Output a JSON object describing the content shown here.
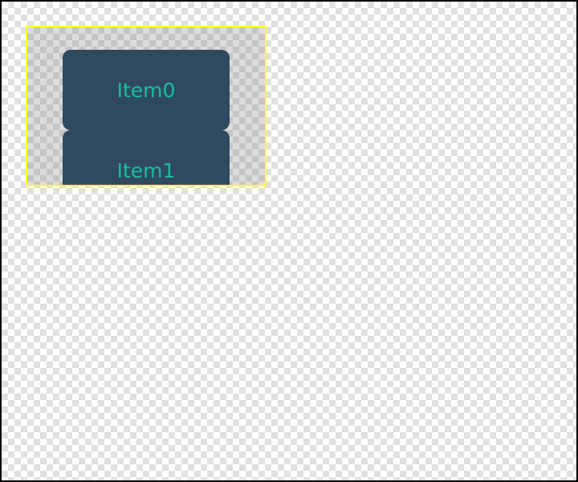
{
  "colors": {
    "item_background": "#2f4a60",
    "item_text": "#1abc9c",
    "viewport_border": "#ffff33",
    "frame_border": "#000000"
  },
  "list": {
    "items": [
      {
        "label": "Item0"
      },
      {
        "label": "Item1"
      }
    ]
  }
}
